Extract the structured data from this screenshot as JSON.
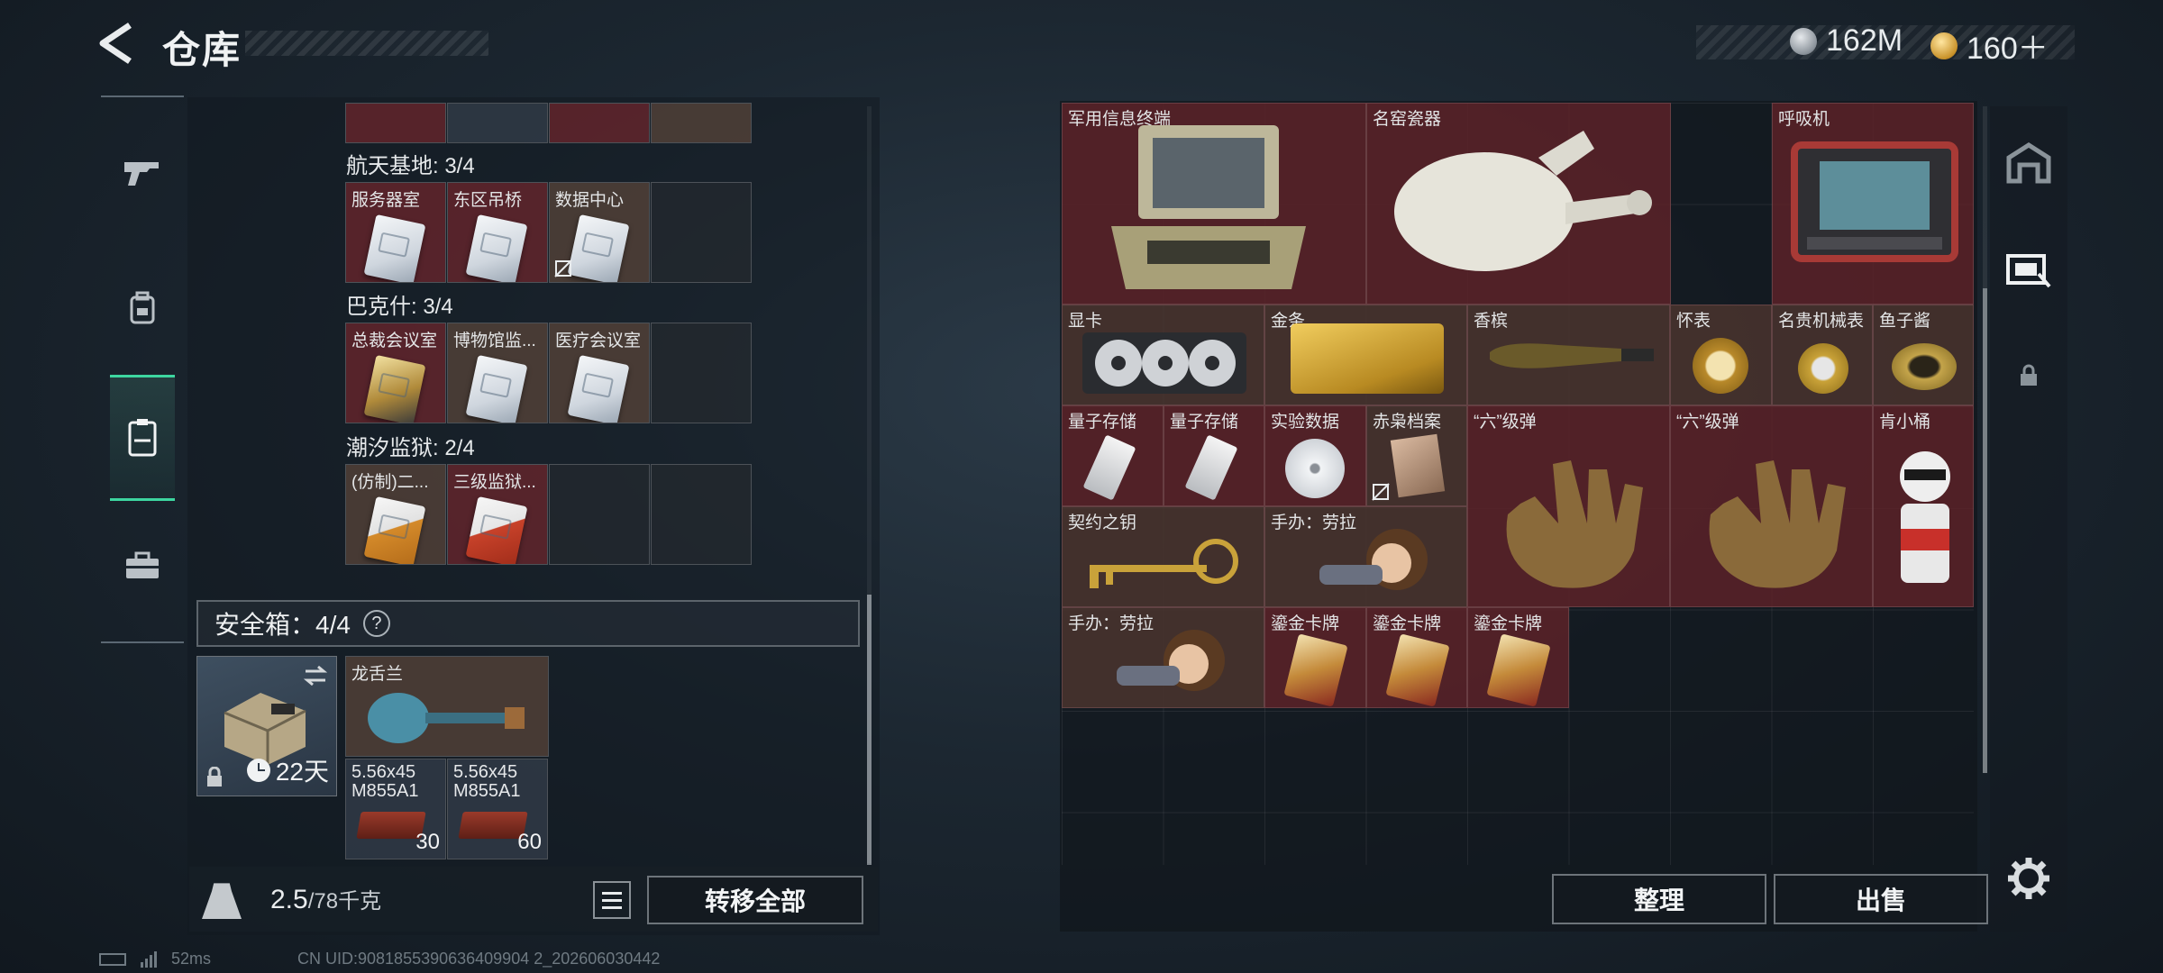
{
  "header": {
    "title": "仓库",
    "currency": [
      {
        "value": "162M",
        "icon": "silver-coin-icon"
      },
      {
        "value": "160＋",
        "icon": "gold-coin-icon"
      }
    ]
  },
  "categories": [
    "gun-icon",
    "backpack-icon",
    "keycard-icon",
    "toolbox-icon"
  ],
  "keycard_groups": [
    {
      "label": "航天基地: 3/4",
      "cards": [
        "服务器室",
        "东区吊桥",
        "数据中心"
      ]
    },
    {
      "label": "巴克什: 3/4",
      "cards": [
        "总裁会议室",
        "博物馆监...",
        "医疗会议室"
      ]
    },
    {
      "label": "潮汐监狱: 2/4",
      "cards": [
        "(仿制)二...",
        "三级监狱..."
      ]
    }
  ],
  "safe_box": {
    "title": "安全箱：4/4",
    "help": "?",
    "timer": "22天",
    "items": [
      {
        "name": "龙舌兰"
      },
      {
        "name": "5.56x45 M855A1",
        "count": "30"
      },
      {
        "name": "5.56x45 M855A1",
        "count": "60"
      }
    ]
  },
  "weight": {
    "current": "2.5",
    "max": "/78千克"
  },
  "buttons": {
    "transfer_all": "转移全部",
    "organize": "整理",
    "sell": "出售"
  },
  "stash_items": [
    {
      "name": "军用信息终端"
    },
    {
      "name": "名窑瓷器"
    },
    {
      "name": "呼吸机"
    },
    {
      "name": "显卡"
    },
    {
      "name": "金条"
    },
    {
      "name": "香槟"
    },
    {
      "name": "怀表"
    },
    {
      "name": "名贵机械表"
    },
    {
      "name": "鱼子酱"
    },
    {
      "name": "量子存储"
    },
    {
      "name": "量子存储"
    },
    {
      "name": "实验数据"
    },
    {
      "name": "赤枭档案"
    },
    {
      "name": "“六”级弹"
    },
    {
      "name": "“六”级弹"
    },
    {
      "name": "肯小桶"
    },
    {
      "name": "契约之钥"
    },
    {
      "name": "手办：劳拉"
    },
    {
      "name": "手办：劳拉"
    },
    {
      "name": "鎏金卡牌"
    },
    {
      "name": "鎏金卡牌"
    },
    {
      "name": "鎏金卡牌"
    }
  ],
  "footer": {
    "ping": "52ms",
    "uid": "CN UID:9081855390636409904 2_202606030442"
  },
  "colors": {
    "accent": "#3dd6a0",
    "legendary_bg": "#5c2228",
    "epic_bg": "#4a342e"
  }
}
